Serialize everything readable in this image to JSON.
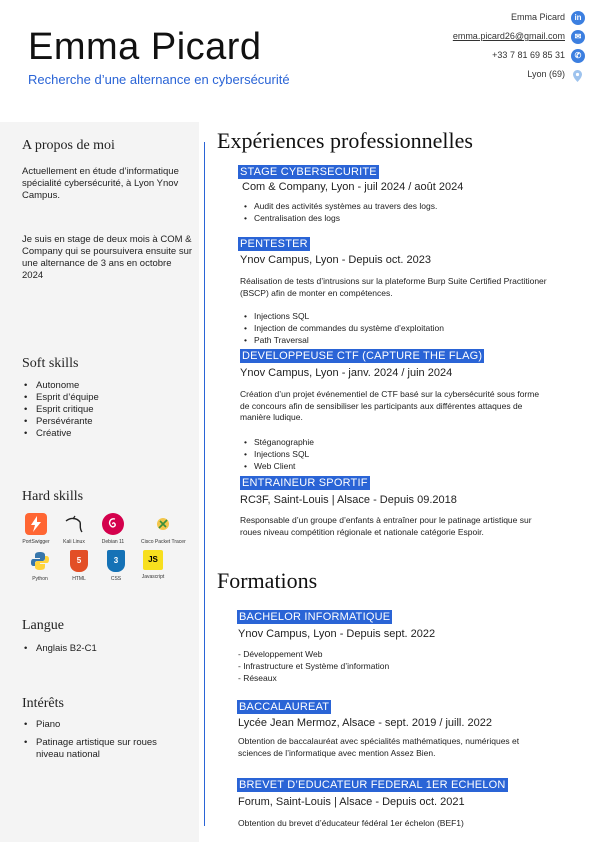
{
  "header": {
    "name": "Emma Picard",
    "subtitle": "Recherche d’une alternance en cybersécurité"
  },
  "contact": {
    "linkedin": "Emma Picard",
    "email": "emma.picard26@gmail.com",
    "phone": "+33 7 81 69 85 31",
    "city": "Lyon (69)",
    "linkedin_icon": "linkedin-icon",
    "email_icon": "email-icon",
    "phone_icon": "phone-icon",
    "location_icon": "location-pin-icon"
  },
  "colors": {
    "accent": "#2a64d6",
    "sidebar_bg": "#f4f4f4"
  },
  "sidebar": {
    "about": {
      "title": "A propos de moi",
      "p1": "Actuellement en étude d’informatique spécialité cybersécurité, à Lyon Ynov Campus.",
      "p2": "Je suis en stage de deux mois à COM & Company qui se poursuivera ensuite sur une alternance de 3 ans en octobre 2024"
    },
    "soft": {
      "title": "Soft skills",
      "items": [
        "Autonome",
        "Esprit d’équipe",
        "Esprit critique",
        "Persévérante",
        "Créative"
      ]
    },
    "hard": {
      "title": "Hard skills",
      "items": [
        {
          "label": "PortSwigger",
          "icon": "portswigger-icon"
        },
        {
          "label": "Kali Linux",
          "icon": "kali-linux-icon"
        },
        {
          "label": "Debian 11",
          "icon": "debian-icon"
        },
        {
          "label": "Cisco Packet Tracer",
          "icon": "cisco-packet-tracer-icon"
        },
        {
          "label": "Python",
          "icon": "python-icon"
        },
        {
          "label": "HTML",
          "icon": "html5-icon"
        },
        {
          "label": "CSS",
          "icon": "css3-icon"
        },
        {
          "label": "Javascript",
          "icon": "javascript-icon",
          "glyph": "JS"
        }
      ]
    },
    "langue": {
      "title": "Langue",
      "items": [
        "Anglais B2-C1"
      ]
    },
    "interets": {
      "title": "Intérêts",
      "items": [
        "Piano",
        "Patinage artistique sur roues niveau national"
      ]
    }
  },
  "experiences": {
    "title": "Expériences professionnelles",
    "items": [
      {
        "tag": "STAGE CYBERSECURITE",
        "sub": "Com & Company, Lyon - juil 2024 / août 2024",
        "bullets": [
          "Audit des activités systèmes au travers des logs.",
          "Centralisation des logs"
        ]
      },
      {
        "tag": "PENTESTER",
        "sub": "Ynov Campus, Lyon - Depuis oct. 2023",
        "desc": "Réalisation de tests d’intrusions sur la plateforme Burp Suite Certified Practitioner (BSCP) afin de monter en compétences.",
        "bullets": [
          "Injections SQL",
          "Injection de commandes du système d’exploitation",
          "Path Traversal"
        ]
      },
      {
        "tag": "DEVELOPPEUSE CTF (CAPTURE THE FLAG)",
        "sub": "Ynov Campus, Lyon - janv. 2024 / juin 2024",
        "desc": "Création d’un projet événementiel de CTF basé sur la cybersécurité sous forme de concours afin de sensibiliser les participants aux différentes attaques de manière ludique.",
        "bullets": [
          "Stéganographie",
          "Injections SQL",
          "Web Client"
        ]
      },
      {
        "tag": "ENTRAINEUR SPORTIF",
        "sub": "RC3F, Saint-Louis | Alsace - Depuis 09.2018",
        "desc": "Responsable d’un groupe d’enfants à entraîner pour le patinage artistique sur roues niveau compétition régionale et nationale catégorie Espoir."
      }
    ]
  },
  "formations": {
    "title": "Formations",
    "items": [
      {
        "tag": "BACHELOR INFORMATIQUE",
        "sub": "Ynov Campus, Lyon - Depuis sept. 2022",
        "lines": [
          "- Développement Web",
          "- Infrastructure et Système d’information",
          "- Réseaux"
        ]
      },
      {
        "tag": "BACCALAUREAT",
        "sub": "Lycée Jean Mermoz, Alsace - sept. 2019 / juill. 2022",
        "desc": "Obtention de baccalauréat avec spécialités mathématiques, numériques et sciences de l’informatique avec mention Assez Bien."
      },
      {
        "tag": "BREVET D’EDUCATEUR FEDERAL 1ER ECHELON",
        "sub": "Forum, Saint-Louis | Alsace - Depuis oct. 2021",
        "desc": "Obtention du brevet d’éducateur fédéral 1er échelon (BEF1)"
      }
    ]
  }
}
